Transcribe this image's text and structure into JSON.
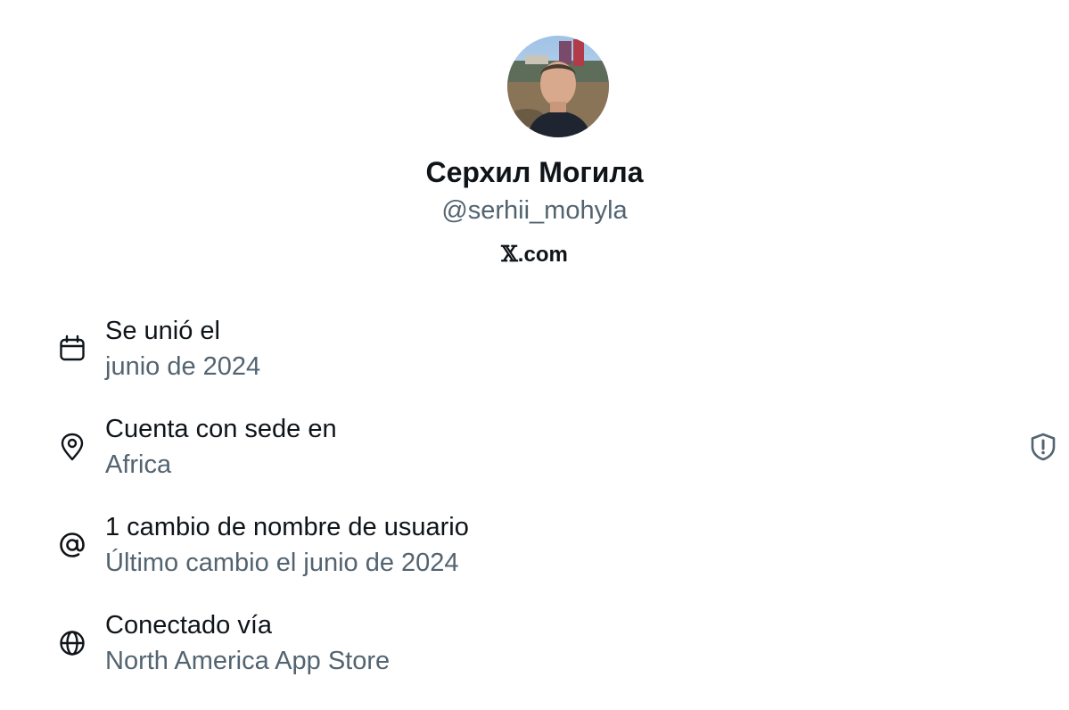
{
  "profile": {
    "display_name": "Серхил Могила",
    "handle": "@serhii_mohyla",
    "platform_mark": "𝕏",
    "platform_suffix": ".com"
  },
  "about": {
    "joined": {
      "title": "Se unió el",
      "value": "junio de 2024",
      "icon": "calendar-icon"
    },
    "location": {
      "title": "Cuenta con sede en",
      "value": "Africa",
      "icon": "location-pin-icon",
      "badge_icon": "shield-alert-icon"
    },
    "username_changes": {
      "title": "1 cambio de nombre de usuario",
      "value": "Último cambio el junio de 2024",
      "icon": "at-sign-icon"
    },
    "connected": {
      "title": "Conectado vía",
      "value": "North America App Store",
      "icon": "globe-icon"
    }
  },
  "colors": {
    "primary_text": "#0f1419",
    "secondary_text": "#536471",
    "background": "#ffffff"
  }
}
